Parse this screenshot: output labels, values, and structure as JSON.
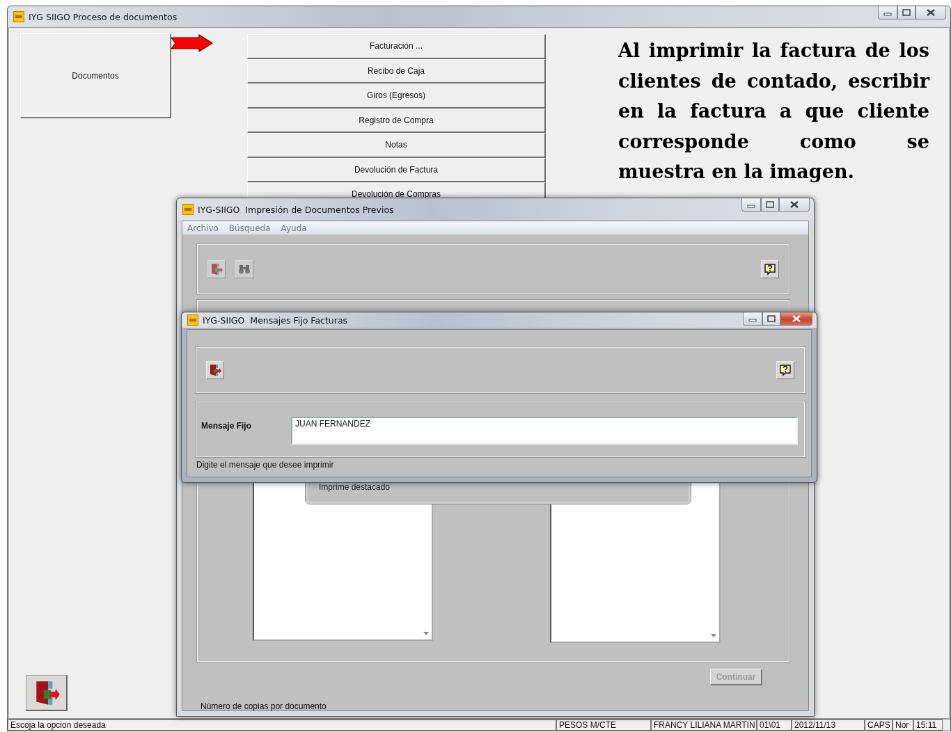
{
  "main_window": {
    "title": "IYG SIIGO Proceso de documentos",
    "module_button": "Documentos",
    "menu_buttons": [
      "Facturación ...",
      "Recibo de Caja",
      "Giros (Egresos)",
      "Registro de Compra",
      "Notas",
      "Devolución de Factura",
      "Devolución de Compras"
    ],
    "status_bar": [
      "Escoja la opcion deseada",
      "PESOS M/CTE",
      "FRANCY LILIANA MARTIN",
      "01\\01",
      "2012/11/13",
      "CAPS",
      "Nor",
      "15:11"
    ]
  },
  "annotation": "Al imprimir la factura de los clientes de contado, escribir en la factura a que cliente corresponde como se muestra en la imagen.",
  "print_dialog": {
    "title": "IYG-SIIGO  Impresión de Documentos Previos",
    "menu": [
      "Archivo",
      "Búsqueda",
      "Ayuda"
    ],
    "option_frame": "Imprime destacado",
    "continue_button": {
      "label": "Continuar",
      "disabled": true
    },
    "footer": "Número de copias por documento"
  },
  "message_dialog": {
    "title": "IYG-SIIGO  Mensajes Fijo Facturas",
    "field_label": "Mensaje Fijo",
    "field_value": "JUAN FERNANDEZ",
    "footer": "Digite el mensaje que desee imprimir"
  }
}
